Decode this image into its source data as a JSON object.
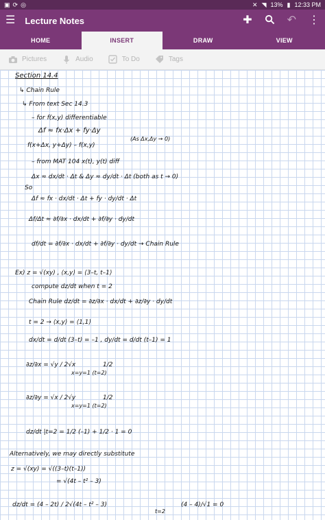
{
  "status_bar": {
    "battery": "13%",
    "time": "12:33 PM"
  },
  "app_bar": {
    "title": "Lecture Notes"
  },
  "tabs": [
    "HOME",
    "INSERT",
    "DRAW",
    "VIEW"
  ],
  "ribbon": {
    "pictures": "Pictures",
    "audio": "Audio",
    "todo": "To Do",
    "tags": "Tags"
  },
  "notes": [
    "Section 14.4",
    "↳ Chain Rule",
    "↳ From text Sec 14.3",
    "– for f(x,y) differentiable",
    "Δf ≈ fx·Δx + fy·Δy",
    "f(x+Δx, y+Δy) – f(x,y)",
    "(As Δx,Δy → 0)",
    "– from MAT 104   x(t), y(t) diff",
    "Δx ≈ dx/dt · Δt   & Δy ≈ dy/dt · Δt   (both as t → 0)",
    "So",
    "Δf ≈ fx · dx/dt · Δt + fy · dy/dt · Δt",
    "Δf/Δt ≈ ∂f/∂x · dx/dt + ∂f/∂y · dy/dt",
    "df/dt = ∂f/∂x · dx/dt + ∂f/∂y · dy/dt  → Chain Rule",
    "Ex)   z = √(xy) ,  ⟨x,y⟩ = ⟨3–t, t–1⟩",
    "compute  dz/dt  when t = 2",
    "Chain Rule   dz/dt = ∂z/∂x · dx/dt + ∂z/∂y · dy/dt",
    "t = 2 → ⟨x,y⟩ = ⟨1,1⟩",
    "dx/dt = d/dt (3–t) = –1 ,   dy/dt = d/dt (t–1) = 1",
    "∂z/∂x = √y / 2√x",
    "x=y=1 (t=2)",
    "1/2",
    "∂z/∂y = √x / 2√y",
    "x=y=1 (t=2)",
    "1/2",
    "dz/dt |t=2 = 1/2 (–1) + 1/2 · 1 = 0",
    "Alternatively, we may directly substitute",
    "z = √(xy)  = √((3–t)(t–1))",
    "= √(4t – t² – 3)",
    "dz/dt = (4 – 2t) / 2√(4t – t² – 3)",
    "t=2",
    "(4 – 4)/√1 = 0"
  ]
}
